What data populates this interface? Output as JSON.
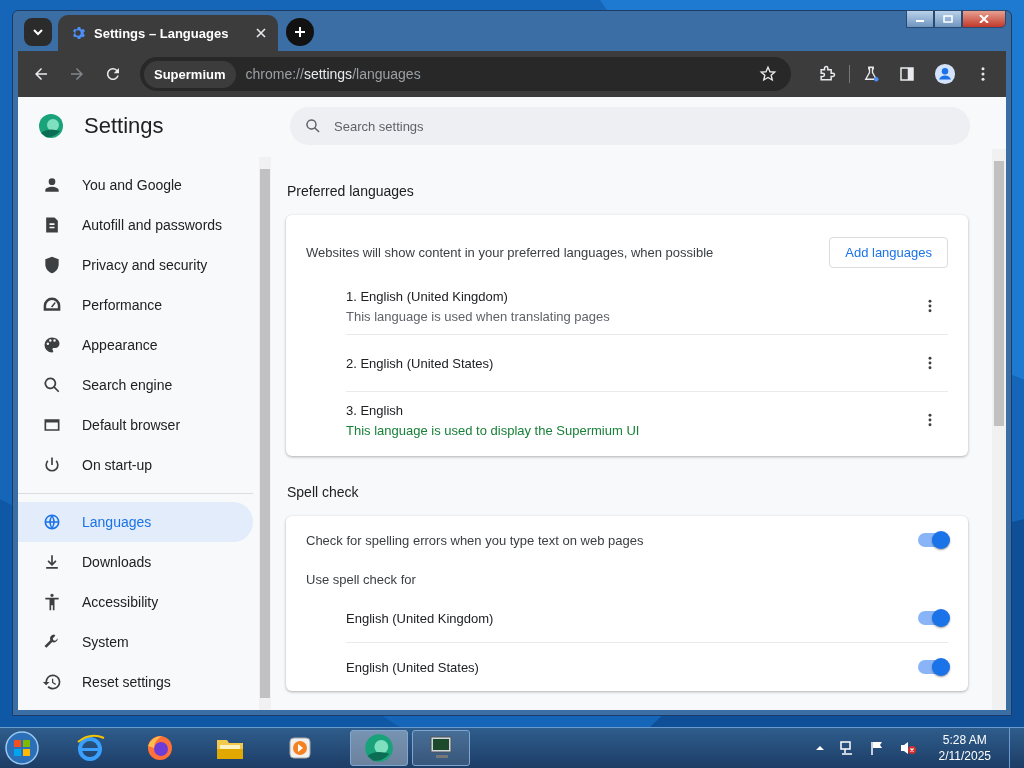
{
  "tab": {
    "title": "Settings – Languages"
  },
  "toolbar": {
    "site_chip": "Supermium",
    "url": "chrome://**settings**/languages"
  },
  "sidebar": {
    "title": "Settings",
    "items": [
      {
        "label": "You and Google",
        "selected": false
      },
      {
        "label": "Autofill and passwords",
        "selected": false
      },
      {
        "label": "Privacy and security",
        "selected": false
      },
      {
        "label": "Performance",
        "selected": false
      },
      {
        "label": "Appearance",
        "selected": false
      },
      {
        "label": "Search engine",
        "selected": false
      },
      {
        "label": "Default browser",
        "selected": false
      },
      {
        "label": "On start-up",
        "selected": false
      },
      {
        "label": "Languages",
        "selected": true
      },
      {
        "label": "Downloads",
        "selected": false
      },
      {
        "label": "Accessibility",
        "selected": false
      },
      {
        "label": "System",
        "selected": false
      },
      {
        "label": "Reset settings",
        "selected": false
      }
    ]
  },
  "search": {
    "placeholder": "Search settings"
  },
  "preferred_languages": {
    "heading": "Preferred languages",
    "description": "Websites will show content in your preferred languages, when possible",
    "button": "Add languages",
    "languages": [
      {
        "name": "1. English (United Kingdom)",
        "note": "This language is used when translating pages",
        "highlighted": false
      },
      {
        "name": "2. English (United States)"
      },
      {
        "name": "3. English",
        "note": "This language is used to display the Supermium UI",
        "highlighted": true
      }
    ]
  },
  "spell_check": {
    "heading": "Spell check",
    "main_toggle": {
      "label": "Check for spelling errors when you type text on web pages",
      "on": true
    },
    "subheading": "Use spell check for",
    "languages": [
      {
        "name": "English (United Kingdom)",
        "on": true
      },
      {
        "name": "English (United States)",
        "on": true
      }
    ]
  },
  "taskbar": {
    "time": "5:28 AM",
    "date": "2/11/2025"
  }
}
